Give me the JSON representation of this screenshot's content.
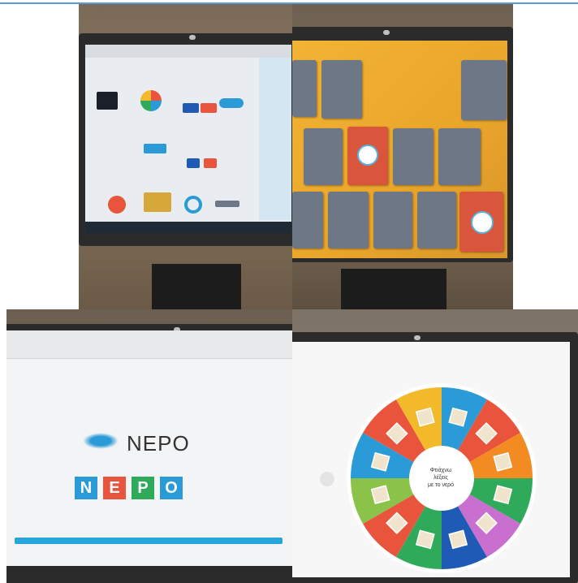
{
  "panels": [
    {
      "id": "top-left",
      "description_label": "wordwall templates page"
    },
    {
      "id": "top-right",
      "description_label": "memory card game"
    },
    {
      "id": "bottom-left",
      "description_label": "NEPO word game"
    },
    {
      "id": "bottom-right",
      "description_label": "spin wheel"
    }
  ],
  "wordgame": {
    "title": "NEPO",
    "letters": [
      "N",
      "E",
      "P",
      "O"
    ],
    "letter_colors": [
      "#2a9bd6",
      "#e8553c",
      "#2eaa5a",
      "#2a9bd6"
    ]
  },
  "wheel": {
    "center_lines": [
      "Φτιάχνω",
      "λέξεις",
      "με το νερό"
    ],
    "segment_colors": [
      "#2a9bd6",
      "#e8553c",
      "#f28b22",
      "#2eaa5a",
      "#c96fcf",
      "#1f5bb5",
      "#2eaa5a",
      "#e8553c",
      "#8bc34a",
      "#2a9bd6",
      "#e8553c",
      "#f2b92b"
    ]
  },
  "colors": {
    "accent_line": "#5b9bd5",
    "memory_bg": "#f2b335",
    "card_closed": "#6e7785",
    "card_open": "#d9553b"
  }
}
